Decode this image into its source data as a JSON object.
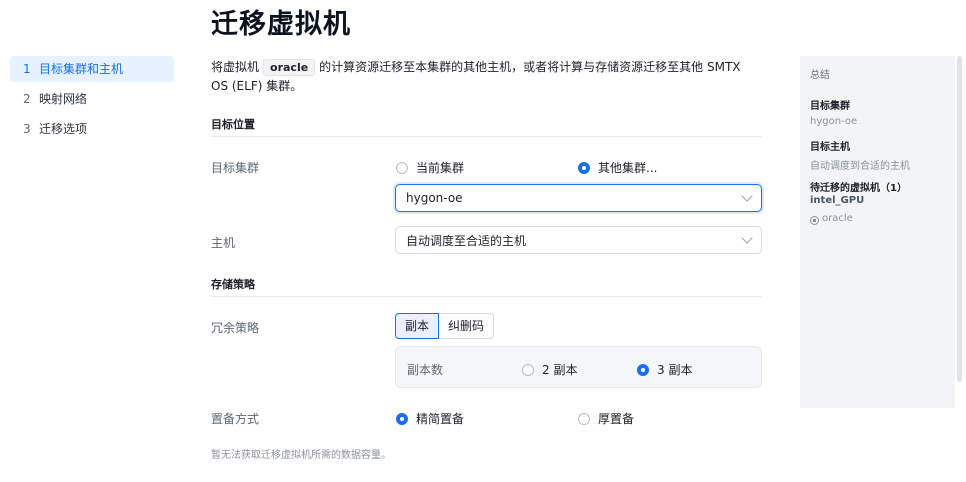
{
  "page": {
    "title": "迁移虚拟机"
  },
  "steps": [
    {
      "num": "1",
      "label": "目标集群和主机"
    },
    {
      "num": "2",
      "label": "映射网络"
    },
    {
      "num": "3",
      "label": "迁移选项"
    }
  ],
  "intro": {
    "pre": "将虚拟机",
    "vm": "oracle",
    "post": "的计算资源迁移至本集群的其他主机，或者将计算与存储资源迁移至其他 SMTX OS (ELF) 集群。"
  },
  "target": {
    "section": "目标位置",
    "cluster_label": "目标集群",
    "opt_current": "当前集群",
    "opt_other": "其他集群...",
    "selected": "other",
    "cluster_value": "hygon-oe",
    "host_label": "主机",
    "host_value": "自动调度至合适的主机"
  },
  "storage": {
    "section": "存储策略",
    "redundancy_label": "冗余策略",
    "tab_replica": "副本",
    "tab_ec": "纠删码",
    "replica_count_label": "副本数",
    "opt_2": "2 副本",
    "opt_3": "3 副本",
    "selected_replica": "3",
    "provision_label": "置备方式",
    "opt_thin": "精简置备",
    "opt_thick": "厚置备",
    "selected_provision": "thin"
  },
  "note": "暂无法获取迁移虚拟机所需的数据容量。",
  "summary": {
    "title": "总结",
    "cluster_key": "目标集群",
    "cluster_val": "hygon-oe",
    "host_key": "目标主机",
    "host_val": "自动调度到合适的主机",
    "vm_key": "待迁移的虚拟机（1）",
    "vm_group": "intel_GPU",
    "vm_name": "oracle"
  },
  "colors": {
    "accent": "#1a6ff0",
    "panel": "#f3f4f6"
  }
}
